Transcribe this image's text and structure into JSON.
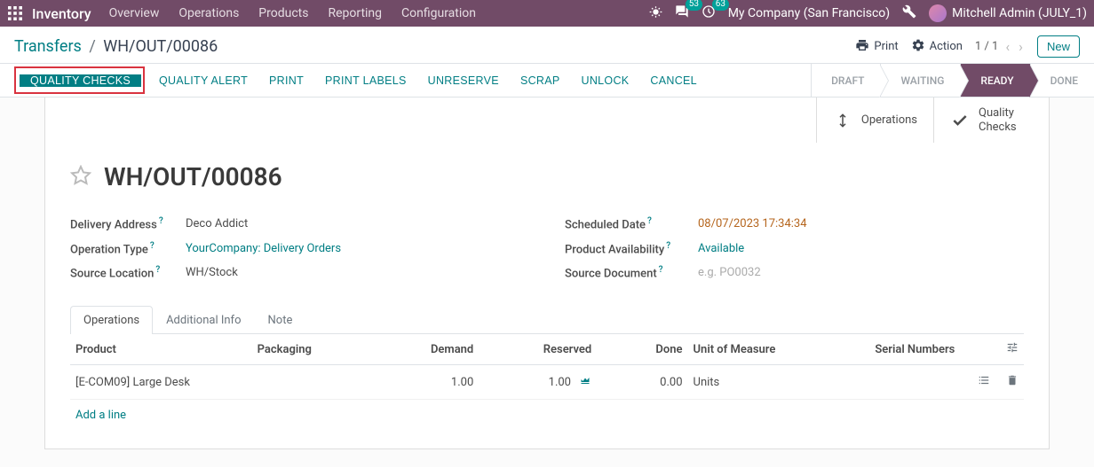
{
  "topnav": {
    "brand": "Inventory",
    "menu": [
      "Overview",
      "Operations",
      "Products",
      "Reporting",
      "Configuration"
    ],
    "msg_count": "53",
    "activity_count": "63",
    "company": "My Company (San Francisco)",
    "user": "Mitchell Admin (JULY_1)"
  },
  "breadcrumb": {
    "root": "Transfers",
    "current": "WH/OUT/00086"
  },
  "control": {
    "print": "Print",
    "action": "Action",
    "pager": "1 / 1",
    "new": "New"
  },
  "buttons": {
    "quality_checks": "QUALITY CHECKS",
    "quality_alert": "QUALITY ALERT",
    "print": "PRINT",
    "print_labels": "PRINT LABELS",
    "unreserve": "UNRESERVE",
    "scrap": "SCRAP",
    "unlock": "UNLOCK",
    "cancel": "CANCEL"
  },
  "status": {
    "draft": "DRAFT",
    "waiting": "WAITING",
    "ready": "READY",
    "done": "DONE"
  },
  "stat_buttons": {
    "operations": "Operations",
    "quality_checks": "Quality Checks"
  },
  "record": {
    "title": "WH/OUT/00086",
    "delivery_address_label": "Delivery Address",
    "delivery_address": "Deco Addict",
    "operation_type_label": "Operation Type",
    "operation_type": "YourCompany: Delivery Orders",
    "source_location_label": "Source Location",
    "source_location": "WH/Stock",
    "scheduled_date_label": "Scheduled Date",
    "scheduled_date": "08/07/2023 17:34:34",
    "product_availability_label": "Product Availability",
    "product_availability": "Available",
    "source_document_label": "Source Document",
    "source_document_placeholder": "e.g. PO0032"
  },
  "tabs": {
    "operations": "Operations",
    "additional_info": "Additional Info",
    "note": "Note"
  },
  "table": {
    "headers": {
      "product": "Product",
      "packaging": "Packaging",
      "demand": "Demand",
      "reserved": "Reserved",
      "done": "Done",
      "uom": "Unit of Measure",
      "serial": "Serial Numbers"
    },
    "rows": [
      {
        "product": "[E-COM09] Large Desk",
        "packaging": "",
        "demand": "1.00",
        "reserved": "1.00",
        "done": "0.00",
        "uom": "Units",
        "serial": ""
      }
    ],
    "add_line": "Add a line"
  }
}
